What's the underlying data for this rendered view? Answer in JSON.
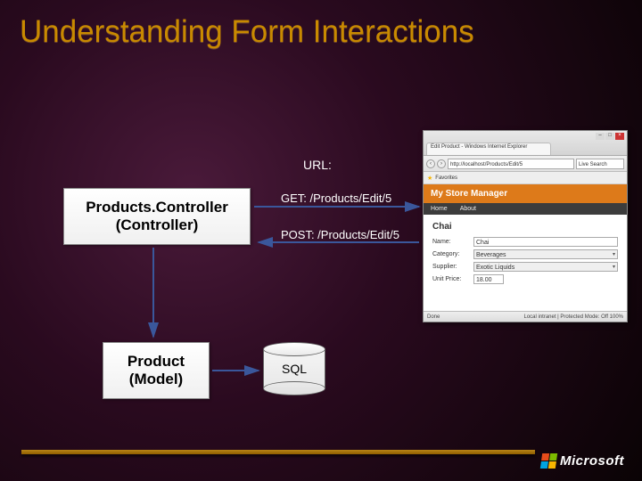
{
  "title": "Understanding Form Interactions",
  "url_label": "URL:",
  "requests": {
    "get": "GET: /Products/Edit/5",
    "post": "POST: /Products/Edit/5"
  },
  "controller": {
    "name": "Products.Controller",
    "base": "(Controller)"
  },
  "model": {
    "name": "Product",
    "base": "(Model)"
  },
  "db_label": "SQL",
  "logo_text": "Microsoft",
  "browser": {
    "tab_title": "Edit Product - Windows Internet Explorer",
    "address": "http://localhost/Products/Edit/5",
    "search_placeholder": "Live Search",
    "favorites_label": "Favorites",
    "site_title": "My Store Manager",
    "nav_items": [
      "Home",
      "About"
    ],
    "product_name": "Chai",
    "fields": [
      {
        "label": "Name:",
        "value": "Chai",
        "type": "text"
      },
      {
        "label": "Category:",
        "value": "Beverages",
        "type": "select"
      },
      {
        "label": "Supplier:",
        "value": "Exotic Liquids",
        "type": "select"
      },
      {
        "label": "Unit Price:",
        "value": "18.00",
        "type": "text"
      }
    ],
    "status_left": "Done",
    "status_right": "Local intranet | Protected Mode: Off   100%"
  }
}
